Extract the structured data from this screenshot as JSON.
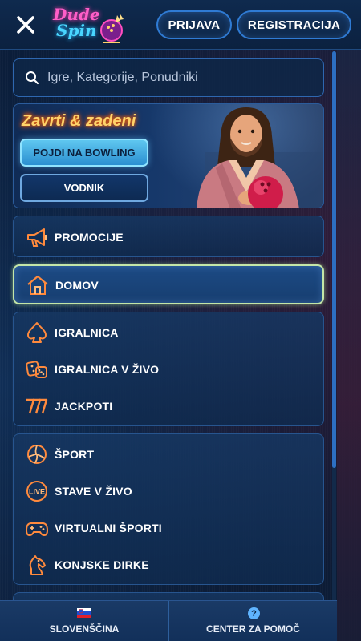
{
  "header": {
    "logo_line1": "Dude",
    "logo_line2": "Spin",
    "login_label": "PRIJAVA",
    "register_label": "REGISTRACIJA"
  },
  "search": {
    "placeholder": "Igre, Kategorije, Ponudniki"
  },
  "banner": {
    "title": "Zavrti & zadeni",
    "primary_button": "POJDI NA BOWLING",
    "secondary_button": "VODNIK"
  },
  "menu": {
    "promotions": "PROMOCIJE",
    "home": "DOMOV",
    "casino": "IGRALNICA",
    "live_casino": "IGRALNICA V ŽIVO",
    "jackpots": "JACKPOTI",
    "sport": "ŠPORT",
    "live_bets": "STAVE V ŽIVO",
    "virtual_sports": "VIRTUALNI ŠPORTI",
    "horse_racing": "KONJSKE DIRKE"
  },
  "footer": {
    "language": "SLOVENŠČINA",
    "help_center": "CENTER ZA POMOČ",
    "help_icon_glyph": "?"
  },
  "icons": {
    "close": "close-icon",
    "search": "search-icon",
    "megaphone": "megaphone-icon",
    "home": "home-icon",
    "spade": "spade-icon",
    "dice": "dice-icon",
    "sevens": "sevens-icon",
    "ball": "volleyball-icon",
    "live": "live-icon",
    "gamepad": "gamepad-icon",
    "horse": "horse-icon",
    "flag": "slovenia-flag-icon"
  },
  "colors": {
    "accent_pink": "#ff5ec8",
    "accent_cyan": "#49d6ff",
    "active_border": "#c4e6a8",
    "icon_orange": "#ff8a3d"
  }
}
